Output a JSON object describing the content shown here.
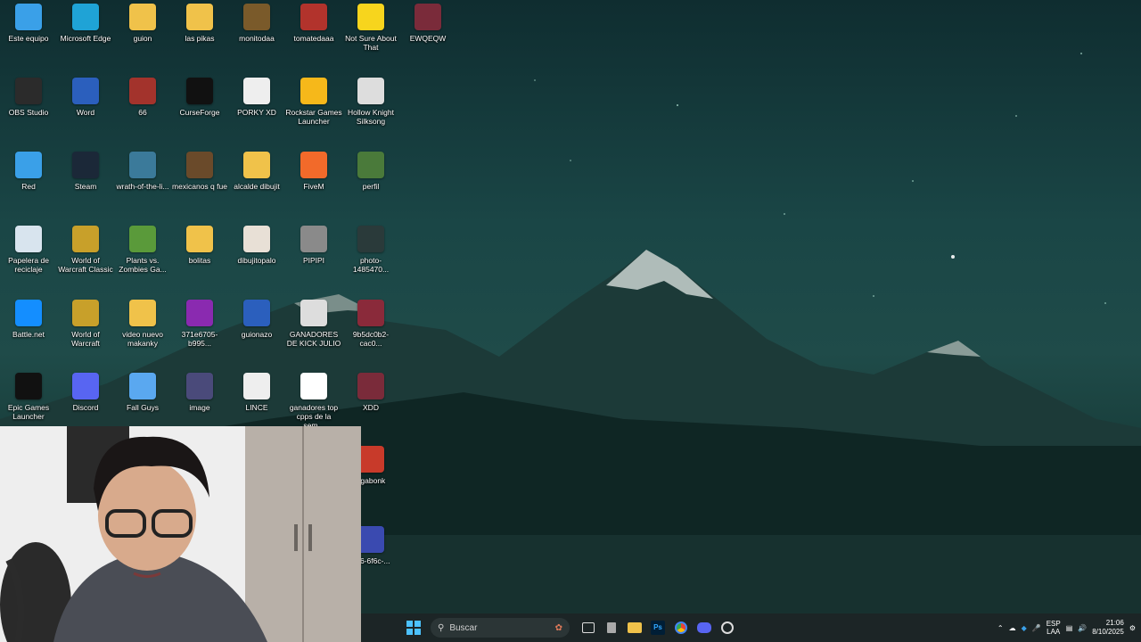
{
  "desktop": {
    "icons": [
      {
        "label": "Este equipo",
        "icon": "monitor-icon",
        "color": "#3aa0e8"
      },
      {
        "label": "Microsoft Edge",
        "icon": "edge-icon",
        "color": "#1fa3d6"
      },
      {
        "label": "guion",
        "icon": "folder-icon",
        "color": "#f0c24a"
      },
      {
        "label": "las pikas",
        "icon": "folder-icon",
        "color": "#f0c24a"
      },
      {
        "label": "monitodaa",
        "icon": "image-file-icon",
        "color": "#7a5a2a"
      },
      {
        "label": "tomatedaaa",
        "icon": "image-file-icon",
        "color": "#b2332c"
      },
      {
        "label": "Not Sure About That",
        "icon": "duck-icon",
        "color": "#f7d51d"
      },
      {
        "label": "EWQEQW",
        "icon": "image-file-icon",
        "color": "#7a2b3a"
      },
      {
        "label": "OBS Studio",
        "icon": "obs-icon",
        "color": "#2b2b2b"
      },
      {
        "label": "Word",
        "icon": "word-icon",
        "color": "#2b5fbd"
      },
      {
        "label": "66",
        "icon": "image-file-icon",
        "color": "#a3332c"
      },
      {
        "label": "CurseForge",
        "icon": "curseforge-icon",
        "color": "#111111"
      },
      {
        "label": "PORKY XD",
        "icon": "video-file-icon",
        "color": "#eeeeee"
      },
      {
        "label": "Rockstar Games Launcher",
        "icon": "rockstar-icon",
        "color": "#f6b81a"
      },
      {
        "label": "Hollow Knight Silksong",
        "icon": "hollow-knight-icon",
        "color": "#dddddd"
      },
      {
        "label": "Red",
        "icon": "network-icon",
        "color": "#3aa0e8"
      },
      {
        "label": "Steam",
        "icon": "steam-icon",
        "color": "#1b2838"
      },
      {
        "label": "wrath-of-the-li...",
        "icon": "image-file-icon",
        "color": "#3b7a9a"
      },
      {
        "label": "mexicanos q fue",
        "icon": "image-file-icon",
        "color": "#6a4a2a"
      },
      {
        "label": "alcalde dibujit",
        "icon": "folder-icon",
        "color": "#f0c24a"
      },
      {
        "label": "FiveM",
        "icon": "fivem-icon",
        "color": "#f26a2a"
      },
      {
        "label": "perfil",
        "icon": "image-file-icon",
        "color": "#4a7a3a"
      },
      {
        "label": "Papelera de reciclaje",
        "icon": "recycle-bin-icon",
        "color": "#d8e4ee"
      },
      {
        "label": "World of Warcraft Classic",
        "icon": "wow-icon",
        "color": "#c8a02a"
      },
      {
        "label": "Plants vs. Zombies Ga...",
        "icon": "pvz-icon",
        "color": "#5a9a3a"
      },
      {
        "label": "bolitas",
        "icon": "folder-icon",
        "color": "#f0c24a"
      },
      {
        "label": "dibujitopalo",
        "icon": "image-file-icon",
        "color": "#e8e0d6"
      },
      {
        "label": "PIPIPI",
        "icon": "image-file-icon",
        "color": "#8a8a8a"
      },
      {
        "label": "photo-1485470...",
        "icon": "image-file-icon",
        "color": "#2a3a3a"
      },
      {
        "label": "Battle.net",
        "icon": "battlenet-icon",
        "color": "#148eff"
      },
      {
        "label": "World of Warcraft",
        "icon": "wow-icon",
        "color": "#c8a02a"
      },
      {
        "label": "video nuevo makanky",
        "icon": "folder-icon",
        "color": "#f0c24a"
      },
      {
        "label": "371e6705-b995...",
        "icon": "image-file-icon",
        "color": "#8a2ab0"
      },
      {
        "label": "guionazo",
        "icon": "word-doc-icon",
        "color": "#2b5fbd"
      },
      {
        "label": "GANADORES DE KICK JULIO",
        "icon": "image-file-icon",
        "color": "#dddddd"
      },
      {
        "label": "9b5dc0b2-cac0...",
        "icon": "image-file-icon",
        "color": "#8a2a3a"
      },
      {
        "label": "Epic Games Launcher",
        "icon": "epic-icon",
        "color": "#111111"
      },
      {
        "label": "Discord",
        "icon": "discord-icon",
        "color": "#5865f2"
      },
      {
        "label": "Fall Guys",
        "icon": "fallguys-icon",
        "color": "#5aa8f0"
      },
      {
        "label": "image",
        "icon": "image-file-icon",
        "color": "#4a4a7a"
      },
      {
        "label": "LINCE",
        "icon": "video-file-icon",
        "color": "#eeeeee"
      },
      {
        "label": "ganadores top cpps de la sem...",
        "icon": "image-file-icon",
        "color": "#ffffff"
      },
      {
        "label": "XDD",
        "icon": "image-file-icon",
        "color": "#7a2b3a"
      },
      {
        "label": "egabonk",
        "icon": "megabonk-icon",
        "color": "#c83a2a"
      },
      {
        "label": "436-6f6c-...",
        "icon": "image-file-icon",
        "color": "#3a4ab0"
      }
    ]
  },
  "taskbar": {
    "search_placeholder": "Buscar",
    "lang_line1": "ESP",
    "lang_line2": "LAA",
    "time": "21:06",
    "date": "8/10/2025"
  },
  "colors": {
    "taskbar_bg": "#1c2526",
    "accent": "#3aa0e8"
  }
}
